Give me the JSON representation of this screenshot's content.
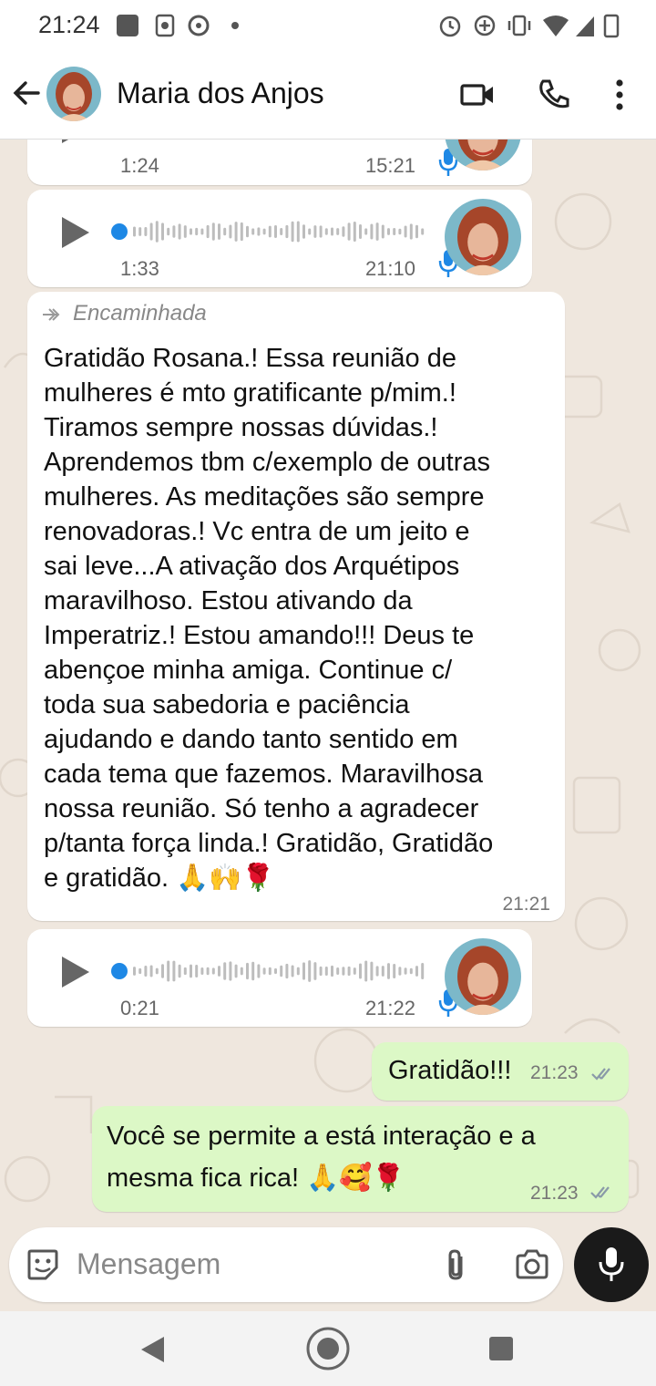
{
  "status_bar": {
    "time": "21:24",
    "left_icons": [
      "gallery-icon",
      "sync-icon",
      "chat-bubble-icon",
      "dot-icon"
    ],
    "right_icons": [
      "alarm-icon",
      "data-saver-icon",
      "vibrate-icon",
      "wifi-icon",
      "signal-icon",
      "battery-icon"
    ]
  },
  "header": {
    "contact_name": "Maria dos Anjos",
    "icons": [
      "back-arrow-icon",
      "video-call-icon",
      "phone-call-icon",
      "more-options-icon"
    ]
  },
  "messages": [
    {
      "type": "audio",
      "direction": "in",
      "duration": "1:24",
      "time": "15:21"
    },
    {
      "type": "audio",
      "direction": "in",
      "duration": "1:33",
      "time": "21:10"
    },
    {
      "type": "text",
      "direction": "in",
      "forwarded_label": "Encaminhada",
      "lines": [
        "Gratidão Rosana.! Essa reunião de",
        "mulheres é mto gratificante p/mim.!",
        "Tiramos sempre nossas dúvidas.!",
        "Aprendemos tbm c/exemplo de outras",
        "mulheres. As meditações são sempre",
        "renovadoras.! Vc entra de um jeito e",
        "sai leve...A ativação dos Arquétipos",
        "maravilhoso. Estou ativando da",
        "Imperatriz.! Estou amando!!! Deus te",
        "abençoe minha amiga. Continue c/",
        "toda sua sabedoria e paciência",
        "ajudando e dando tanto sentido em",
        "cada tema que fazemos. Maravilhosa",
        "nossa reunião. Só tenho a agradecer",
        "p/tanta força linda.! Gratidão, Gratidão",
        "e gratidão. 🙏🙌🌹"
      ],
      "time": "21:21"
    },
    {
      "type": "audio",
      "direction": "in",
      "duration": "0:21",
      "time": "21:22"
    },
    {
      "type": "text",
      "direction": "out",
      "lines": [
        "Gratidão!!!"
      ],
      "time": "21:23",
      "status": "read"
    },
    {
      "type": "text",
      "direction": "out",
      "lines": [
        "Você se permite a está interação e a",
        "mesma fica rica! 🙏🥰🌹"
      ],
      "time": "21:23",
      "status": "read"
    }
  ],
  "composer": {
    "placeholder": "Mensagem",
    "icons": [
      "sticker-icon",
      "attach-icon",
      "camera-icon",
      "mic-icon"
    ]
  },
  "nav_bar": {
    "icons": [
      "nav-back-icon",
      "nav-home-icon",
      "nav-recents-icon"
    ]
  },
  "colors": {
    "chat_bg": "#efe7de",
    "outgoing_bubble": "#dcf8c6",
    "incoming_bubble": "#ffffff",
    "audio_accent": "#1e88e5",
    "read_ticks": "#8a9aa8"
  }
}
